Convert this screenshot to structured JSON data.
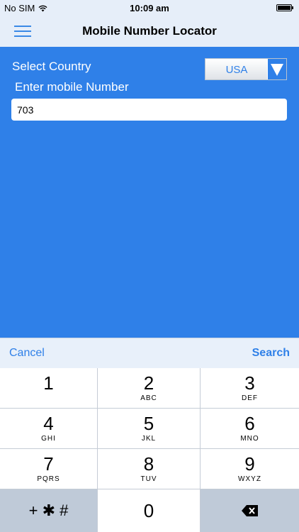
{
  "status": {
    "carrier": "No SIM",
    "time": "10:09 am"
  },
  "nav": {
    "title": "Mobile Number Locator"
  },
  "form": {
    "country_label": "Select Country",
    "country_value": "USA",
    "number_label": "Enter mobile Number",
    "number_value": "703"
  },
  "accessory": {
    "cancel": "Cancel",
    "search": "Search"
  },
  "keypad": {
    "keys": [
      {
        "digit": "1",
        "letters": ""
      },
      {
        "digit": "2",
        "letters": "ABC"
      },
      {
        "digit": "3",
        "letters": "DEF"
      },
      {
        "digit": "4",
        "letters": "GHI"
      },
      {
        "digit": "5",
        "letters": "JKL"
      },
      {
        "digit": "6",
        "letters": "MNO"
      },
      {
        "digit": "7",
        "letters": "PQRS"
      },
      {
        "digit": "8",
        "letters": "TUV"
      },
      {
        "digit": "9",
        "letters": "WXYZ"
      }
    ],
    "symbols": "+ ✱ #",
    "zero": "0"
  },
  "colors": {
    "accent": "#2f80e8",
    "bar": "#e6eef9"
  }
}
